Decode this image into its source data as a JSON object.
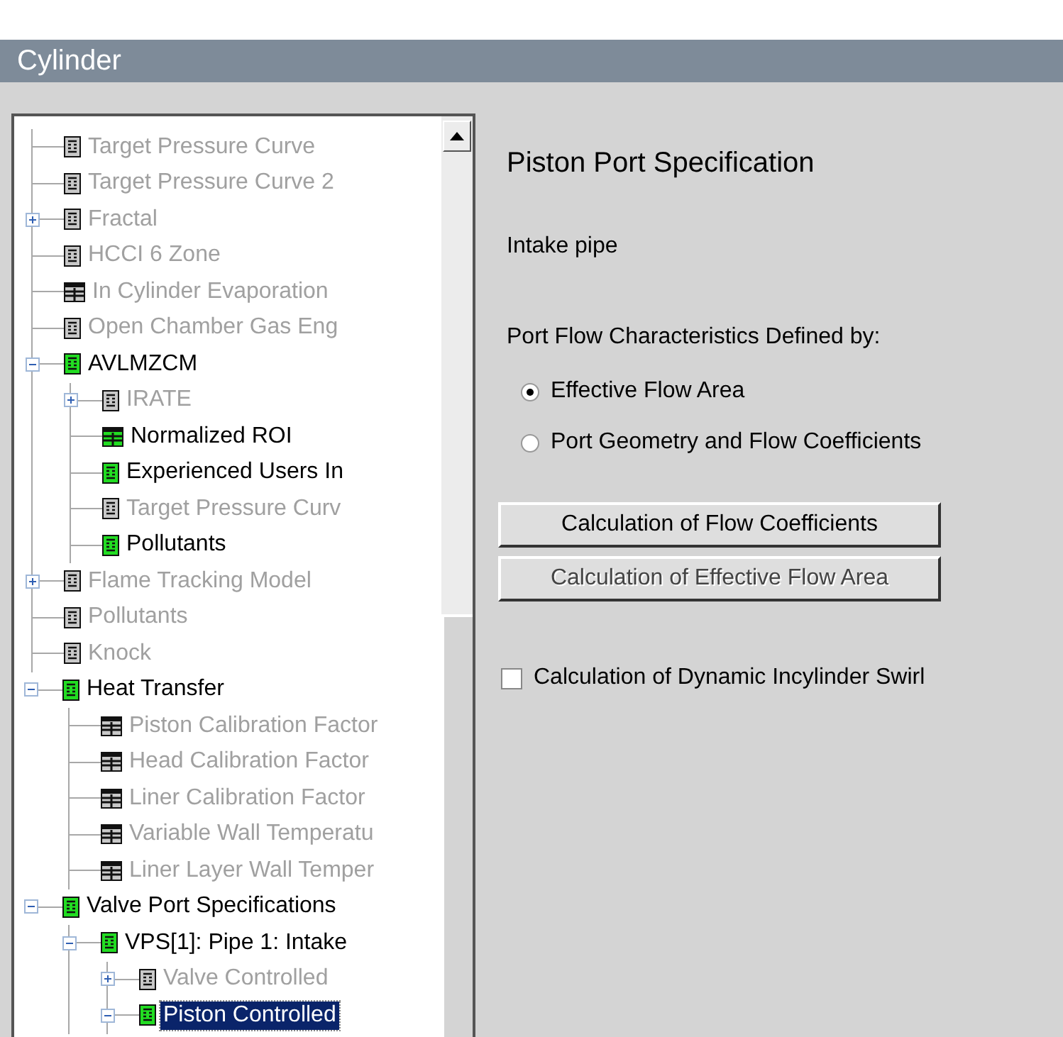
{
  "window": {
    "title": "Cylinder"
  },
  "tree": {
    "items": [
      {
        "children": [
          {
            "label": "Target Pressure Curve",
            "kind": "form",
            "enabled": false,
            "selected": false
          },
          {
            "label": "Target Pressure Curve 2",
            "kind": "form",
            "enabled": false,
            "selected": false
          },
          {
            "label": "Fractal",
            "kind": "form",
            "enabled": false,
            "selected": false,
            "expanded": false
          },
          {
            "label": "HCCI 6 Zone",
            "kind": "form",
            "enabled": false,
            "selected": false
          },
          {
            "label": "In Cylinder Evaporation",
            "kind": "table",
            "enabled": false,
            "selected": false
          },
          {
            "label": "Open Chamber Gas Eng",
            "kind": "form",
            "enabled": false,
            "selected": false
          },
          {
            "label": "AVLMZCM",
            "kind": "form",
            "enabled": true,
            "selected": false,
            "expanded": true,
            "children": [
              {
                "label": "IRATE",
                "kind": "form",
                "enabled": false,
                "selected": false,
                "expanded": false
              },
              {
                "label": "Normalized ROI",
                "kind": "table",
                "enabled": true,
                "selected": false
              },
              {
                "label": "Experienced Users In",
                "kind": "form",
                "enabled": true,
                "selected": false
              },
              {
                "label": "Target Pressure Curv",
                "kind": "form",
                "enabled": false,
                "selected": false
              },
              {
                "label": "Pollutants",
                "kind": "form",
                "enabled": true,
                "selected": false
              }
            ]
          },
          {
            "label": "Flame Tracking Model",
            "kind": "form",
            "enabled": false,
            "selected": false,
            "expanded": false
          },
          {
            "label": "Pollutants",
            "kind": "form",
            "enabled": false,
            "selected": false
          },
          {
            "label": "Knock",
            "kind": "form",
            "enabled": false,
            "selected": false
          }
        ]
      },
      {
        "label": "Heat Transfer",
        "kind": "form",
        "enabled": true,
        "selected": false,
        "expanded": true,
        "children": [
          {
            "label": "Piston Calibration Factor",
            "kind": "table",
            "enabled": false,
            "selected": false
          },
          {
            "label": "Head Calibration Factor",
            "kind": "table",
            "enabled": false,
            "selected": false
          },
          {
            "label": "Liner Calibration Factor",
            "kind": "table",
            "enabled": false,
            "selected": false
          },
          {
            "label": "Variable Wall Temperatu",
            "kind": "table",
            "enabled": false,
            "selected": false
          },
          {
            "label": "Liner Layer Wall Temper",
            "kind": "table",
            "enabled": false,
            "selected": false
          }
        ]
      },
      {
        "label": "Valve Port Specifications",
        "kind": "form",
        "enabled": true,
        "selected": false,
        "expanded": true,
        "children": [
          {
            "label": "VPS[1]: Pipe 1: Intake",
            "kind": "form",
            "enabled": true,
            "selected": false,
            "expanded": true,
            "children": [
              {
                "label": "Valve Controlled",
                "kind": "form",
                "enabled": false,
                "selected": false,
                "expanded": false
              },
              {
                "label": "Piston Controlled",
                "kind": "form",
                "enabled": true,
                "selected": true,
                "expanded": true
              }
            ]
          }
        ]
      }
    ]
  },
  "panel": {
    "heading": "Piston Port Specification",
    "subtitle": "Intake pipe",
    "group_label": "Port Flow Characteristics Defined by:",
    "radios": [
      {
        "label": "Effective Flow Area",
        "selected": true
      },
      {
        "label": "Port Geometry and Flow Coefficients",
        "selected": false
      }
    ],
    "buttons": [
      {
        "label": "Calculation of Flow Coefficients",
        "disabled": false
      },
      {
        "label": "Calculation of Effective Flow Area",
        "disabled": true
      }
    ],
    "checkbox": {
      "label": "Calculation of Dynamic Incylinder Swirl",
      "checked": false
    }
  }
}
